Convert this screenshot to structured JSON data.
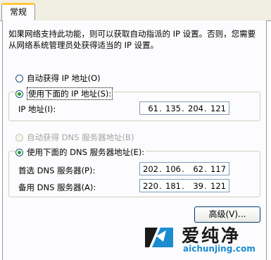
{
  "tab": {
    "label": "常规"
  },
  "description": "如果网络支持此功能，则可以获取自动指派的 IP 设置。否则，您需要从网络系统管理员处获得适当的 IP 设置。",
  "ip_section": {
    "auto_label": "自动获得 IP 地址(O)",
    "manual_label": "使用下面的 IP 地址(S):",
    "ip_label": "IP 地址(I):",
    "ip_value": [
      "61",
      "135",
      "204",
      "121"
    ]
  },
  "dns_section": {
    "auto_label": "自动获得 DNS 服务器地址(B)",
    "manual_label": "使用下面的 DNS 服务器地址(E):",
    "preferred_label": "首选 DNS 服务器(P):",
    "preferred_value": [
      "202",
      "106",
      "62",
      "117"
    ],
    "alternate_label": "备用 DNS 服务器(A):",
    "alternate_value": [
      "220",
      "181",
      "39",
      "121"
    ]
  },
  "advanced_button": "高级(V)...",
  "watermark": {
    "title": "爱纯净",
    "url": "aichunjing.com",
    "color": "#1a8ccf"
  }
}
